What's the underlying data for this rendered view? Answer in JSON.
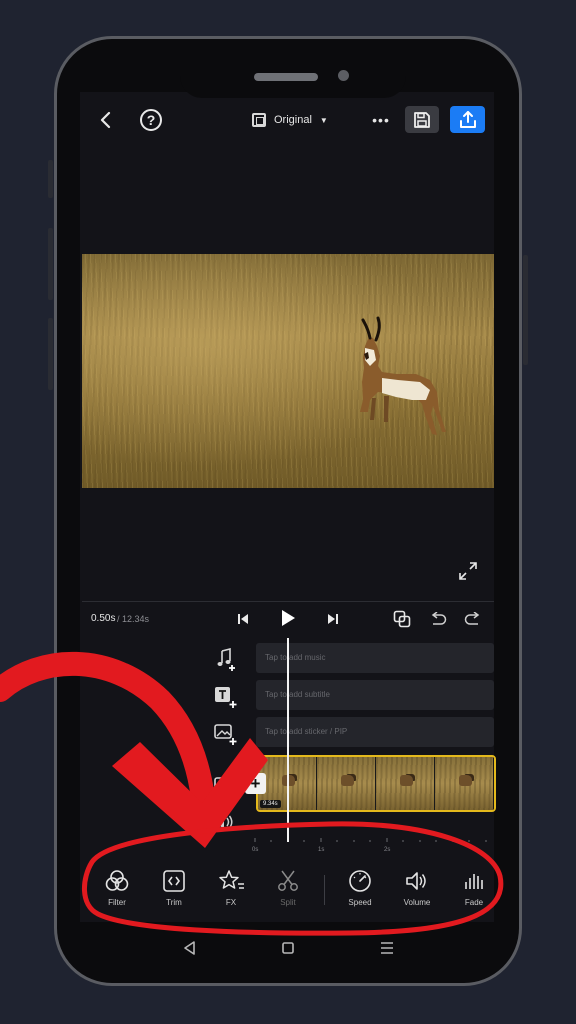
{
  "colors": {
    "accent": "#1b7cf5",
    "clip_border": "#e4b91c",
    "annotation": "#e21a1f",
    "background": "#1f2330"
  },
  "top_bar": {
    "back_icon": "chevron-left-icon",
    "help_icon": "question-circle-icon",
    "help_glyph": "?",
    "aspect_ratio_label": "Original",
    "aspect_ratio_caret": "▼",
    "more_glyph": "•••",
    "save_icon": "floppy-disk-icon",
    "export_icon": "upload-icon"
  },
  "playback": {
    "current_time": "0.50s",
    "total_time": "/ 12.34s",
    "skip_back_icon": "skip-back-icon",
    "play_icon": "play-icon",
    "skip_forward_icon": "skip-forward-icon",
    "keyframe_icon": "keyframe-icon",
    "undo_icon": "undo-icon",
    "redo_icon": "redo-icon"
  },
  "tracks": {
    "music": {
      "icon": "music-note-add-icon",
      "placeholder": "Tap to add music"
    },
    "subtitle": {
      "icon": "text-add-icon",
      "placeholder": "Tap to add subtitle"
    },
    "sticker": {
      "icon": "image-add-icon",
      "placeholder": "Tap to add sticker / PIP"
    },
    "video": {
      "icon": "video-add-icon",
      "clip_duration": "9.34s",
      "add_glyph": "+"
    },
    "audio": {
      "icon": "speaker-icon"
    }
  },
  "ruler": {
    "labels": [
      "0s",
      "1s",
      "2s"
    ]
  },
  "toolbar": {
    "items": [
      {
        "label": "Filter",
        "icon": "filter-circles-icon",
        "enabled": true
      },
      {
        "label": "Trim",
        "icon": "trim-brackets-icon",
        "enabled": true
      },
      {
        "label": "FX",
        "icon": "star-fx-icon",
        "enabled": true
      },
      {
        "label": "Split",
        "icon": "scissors-icon",
        "enabled": false
      },
      {
        "label": "Speed",
        "icon": "speedometer-icon",
        "enabled": true
      },
      {
        "label": "Volume",
        "icon": "volume-icon",
        "enabled": true
      },
      {
        "label": "Fade",
        "icon": "fade-bars-icon",
        "enabled": true
      }
    ]
  },
  "system_nav": {
    "back_icon": "triangle-back-icon",
    "home_icon": "square-home-icon",
    "recents_icon": "menu-lines-icon"
  }
}
